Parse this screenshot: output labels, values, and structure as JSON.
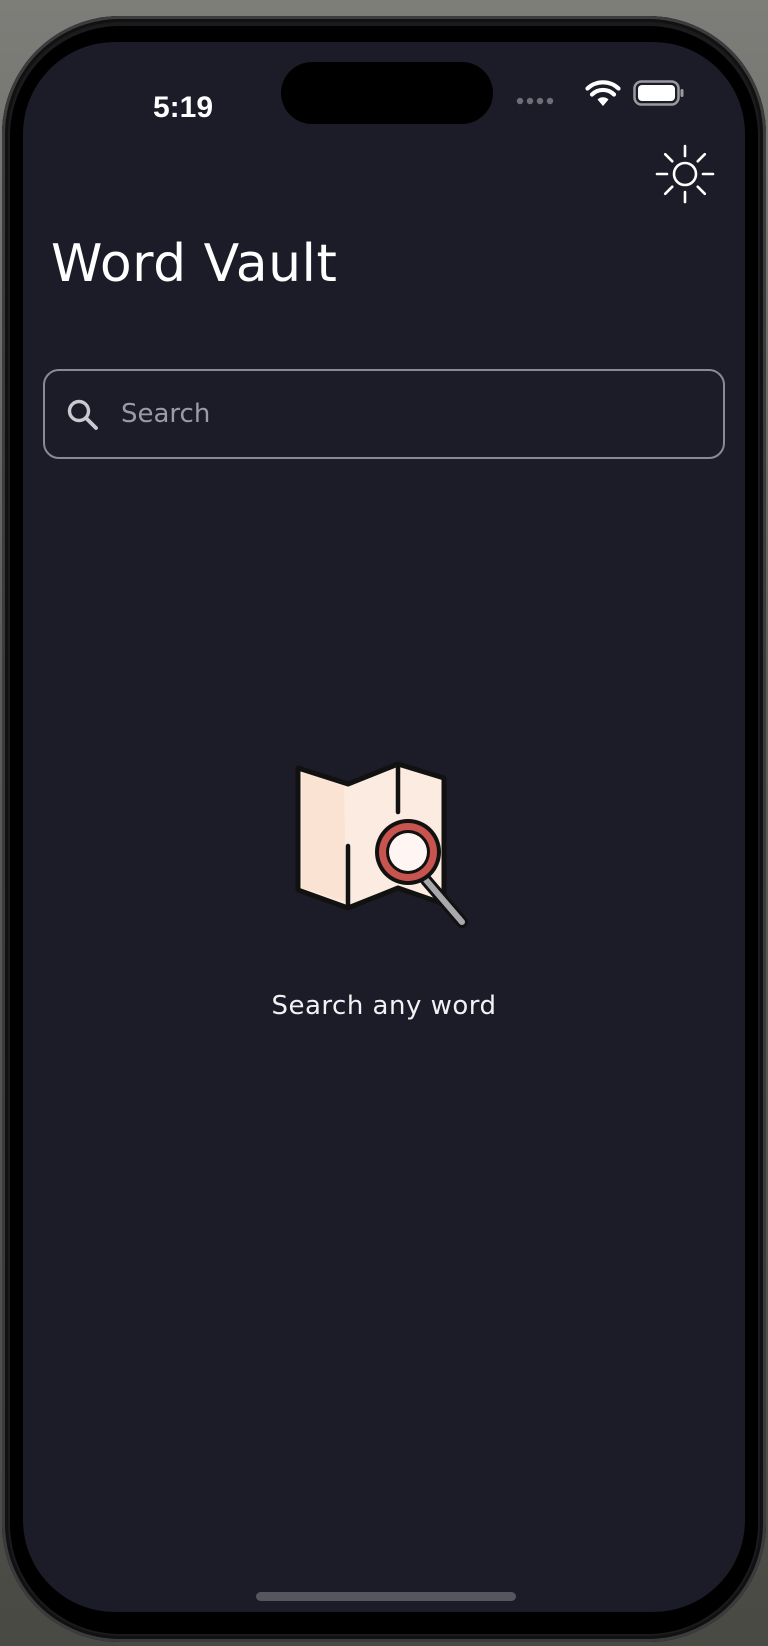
{
  "status_bar": {
    "time": "5:19",
    "icons": [
      "signal-dots-icon",
      "wifi-icon",
      "battery-icon"
    ]
  },
  "header": {
    "title": "Word Vault",
    "theme_toggle_icon": "sun-icon"
  },
  "search": {
    "placeholder": "Search",
    "value": "",
    "icon": "search-icon"
  },
  "empty_state": {
    "illustration": "map-magnifier-icon",
    "message": "Search any word"
  },
  "colors": {
    "background": "#1c1c28",
    "text": "#ffffff",
    "border": "#8a8a96",
    "placeholder": "#9b9ba6",
    "illustration_paper": "#fcebe0",
    "illustration_lens_ring": "#c85450"
  }
}
